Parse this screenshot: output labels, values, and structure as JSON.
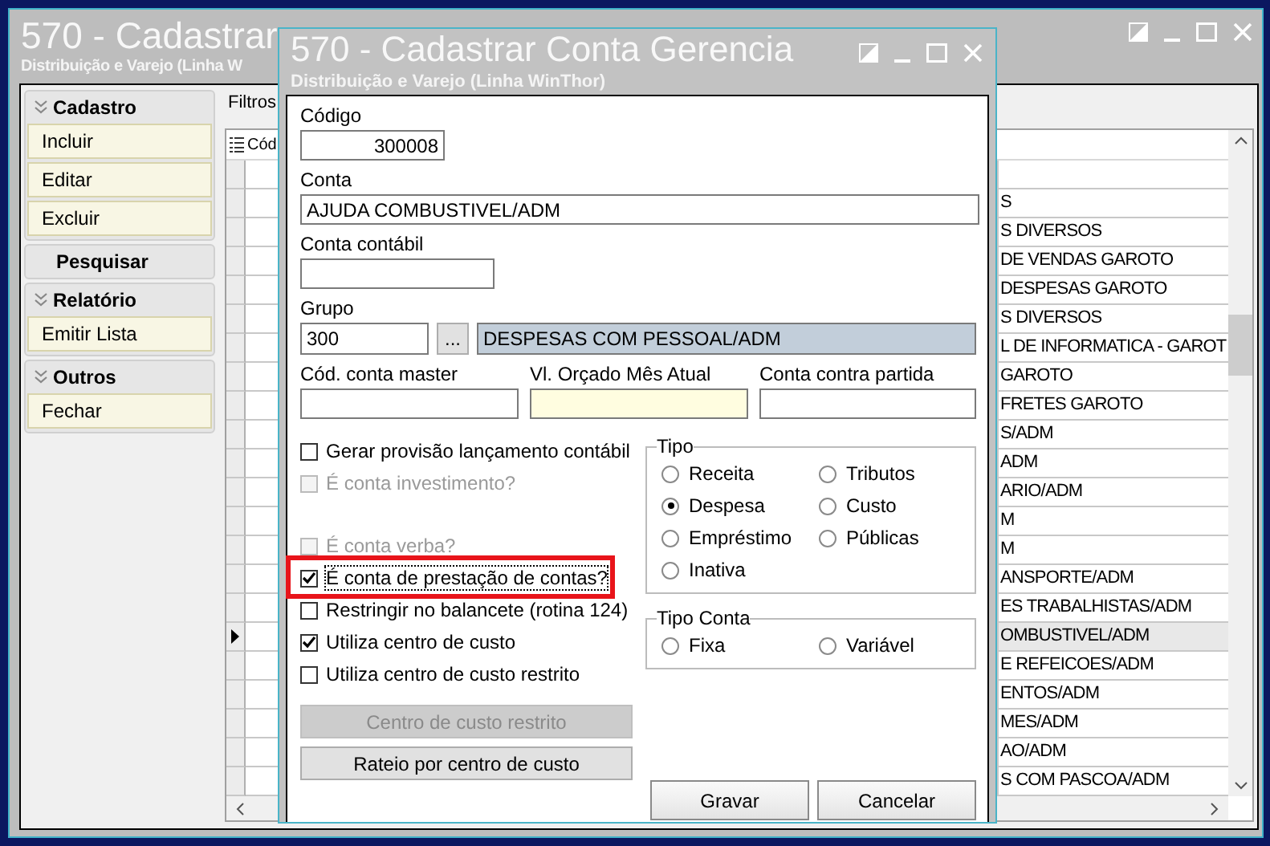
{
  "main_window": {
    "title": "570 - Cadastrar",
    "subtitle": "Distribuição e Varejo (Linha W"
  },
  "sidebar": {
    "groups": [
      {
        "title": "Cadastro",
        "collapsible": true,
        "items": [
          "Incluir",
          "Editar",
          "Excluir"
        ]
      },
      {
        "title": "Pesquisar",
        "collapsible": false
      },
      {
        "title": "Relatório",
        "collapsible": true,
        "items": [
          "Emitir Lista"
        ]
      },
      {
        "title": "Outros",
        "collapsible": true,
        "items": [
          "Fechar"
        ]
      }
    ]
  },
  "filters_label": "Filtros",
  "grid": {
    "header": "Cód",
    "rows": [
      {
        "text": "S",
        "selected": false
      },
      {
        "text": "S DIVERSOS",
        "selected": false
      },
      {
        "text": "DE VENDAS GAROTO",
        "selected": false
      },
      {
        "text": "DESPESAS GAROTO",
        "selected": false
      },
      {
        "text": "S DIVERSOS",
        "selected": false
      },
      {
        "text": "L DE INFORMATICA - GAROT",
        "selected": false
      },
      {
        "text": "GAROTO",
        "selected": false
      },
      {
        "text": "FRETES GAROTO",
        "selected": false
      },
      {
        "text": "S/ADM",
        "selected": false
      },
      {
        "text": "ADM",
        "selected": false
      },
      {
        "text": "ARIO/ADM",
        "selected": false
      },
      {
        "text": "M",
        "selected": false
      },
      {
        "text": "M",
        "selected": false
      },
      {
        "text": "ANSPORTE/ADM",
        "selected": false
      },
      {
        "text": "ES TRABALHISTAS/ADM",
        "selected": false
      },
      {
        "text": "OMBUSTIVEL/ADM",
        "selected": true
      },
      {
        "text": "E REFEICOES/ADM",
        "selected": false
      },
      {
        "text": "ENTOS/ADM",
        "selected": false
      },
      {
        "text": "MES/ADM",
        "selected": false
      },
      {
        "text": "AO/ADM",
        "selected": false
      },
      {
        "text": "S COM PASCOA/ADM",
        "selected": false
      }
    ]
  },
  "dialog": {
    "title": "570 - Cadastrar Conta Gerencia",
    "subtitle": "Distribuição e Varejo (Linha WinThor)",
    "codigo": {
      "label": "Código",
      "value": "300008"
    },
    "conta": {
      "label": "Conta",
      "value": "AJUDA COMBUSTIVEL/ADM"
    },
    "conta_contabil": {
      "label": "Conta contábil"
    },
    "grupo": {
      "label": "Grupo",
      "value": "300",
      "lookup": "...",
      "description": "DESPESAS COM PESSOAL/ADM"
    },
    "row_fields": [
      {
        "label": "Cód. conta master"
      },
      {
        "label": "Vl. Orçado Mês Atual"
      },
      {
        "label": "Conta contra partida"
      }
    ],
    "options_upper": [
      {
        "label": "Gerar provisão lançamento contábil",
        "checked": false,
        "disabled": false,
        "highlighted": false
      },
      {
        "label": "É conta investimento?",
        "checked": false,
        "disabled": true,
        "highlighted": false
      }
    ],
    "options_lower": [
      {
        "label": "É conta verba?",
        "checked": false,
        "disabled": true,
        "highlighted": false
      },
      {
        "label": "É conta de prestação de contas?",
        "checked": true,
        "disabled": false,
        "highlighted": true
      },
      {
        "label": "Restringir no balancete (rotina 124)",
        "checked": false,
        "disabled": false,
        "highlighted": false
      },
      {
        "label": "Utiliza centro de custo",
        "checked": true,
        "disabled": false,
        "highlighted": false
      },
      {
        "label": "Utiliza centro de custo restrito",
        "checked": false,
        "disabled": false,
        "highlighted": false
      }
    ],
    "side_buttons": [
      {
        "label": "Centro de custo restrito",
        "disabled": true
      },
      {
        "label": "Rateio por centro de custo",
        "disabled": false
      }
    ],
    "tipo": {
      "title": "Tipo",
      "options": [
        {
          "label": "Receita",
          "selected": false
        },
        {
          "label": "Tributos",
          "selected": false
        },
        {
          "label": "Despesa",
          "selected": true
        },
        {
          "label": "Custo",
          "selected": false
        },
        {
          "label": "Empréstimo",
          "selected": false
        },
        {
          "label": "Públicas",
          "selected": false
        },
        {
          "label": "Inativa",
          "selected": false
        }
      ]
    },
    "tipo_conta": {
      "title": "Tipo Conta",
      "options": [
        {
          "label": "Fixa",
          "selected": false
        },
        {
          "label": "Variável",
          "selected": false
        }
      ]
    },
    "buttons": [
      "Gravar",
      "Cancelar"
    ]
  }
}
